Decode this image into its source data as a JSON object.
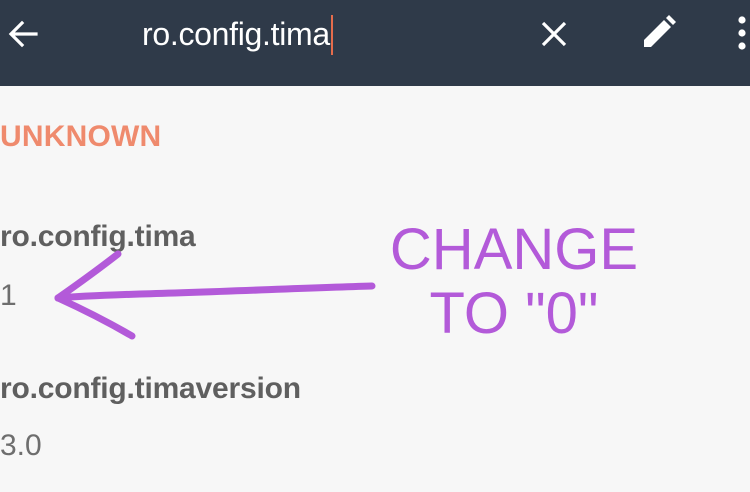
{
  "toolbar": {
    "search_value": "ro.config.tima",
    "back_icon": "arrow-left-icon",
    "clear_icon": "close-icon",
    "edit_icon": "pencil-icon",
    "more_icon": "more-vertical-icon"
  },
  "section": {
    "title": "UNKNOWN"
  },
  "properties": [
    {
      "name": "ro.config.tima",
      "value": "1"
    },
    {
      "name": "ro.config.timaversion",
      "value": "3.0"
    }
  ],
  "annotation": {
    "line1": "CHANGE",
    "line2": "TO \"0\"",
    "color": "#b35ad9"
  },
  "colors": {
    "toolbar_bg": "#2f3a49",
    "accent": "#ef8a6d",
    "caret": "#e56c4c"
  }
}
